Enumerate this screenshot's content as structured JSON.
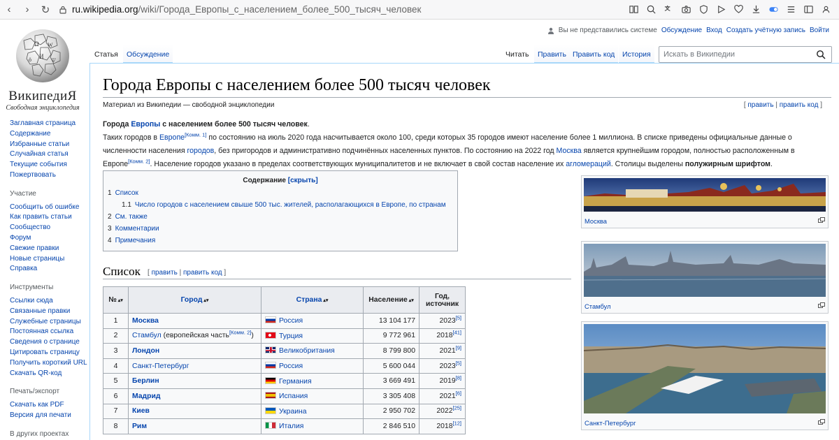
{
  "browser": {
    "url_host": "ru.wikipedia.org",
    "url_path": "/wiki/Города_Европы_с_населением_более_500_тысяч_человек"
  },
  "logo": {
    "wordmark": "ВикипедиЯ",
    "tagline": "Свободная энциклопедия"
  },
  "sidebar": {
    "nav": [
      "Заглавная страница",
      "Содержание",
      "Избранные статьи",
      "Случайная статья",
      "Текущие события",
      "Пожертвовать"
    ],
    "participation_title": "Участие",
    "participation": [
      "Сообщить об ошибке",
      "Как править статьи",
      "Сообщество",
      "Форум",
      "Свежие правки",
      "Новые страницы",
      "Справка"
    ],
    "tools_title": "Инструменты",
    "tools": [
      "Ссылки сюда",
      "Связанные правки",
      "Служебные страницы",
      "Постоянная ссылка",
      "Сведения о странице",
      "Цитировать страницу",
      "Получить короткий URL",
      "Скачать QR-код"
    ],
    "print_title": "Печать/экспорт",
    "print": [
      "Скачать как PDF",
      "Версия для печати"
    ],
    "other_title": "В других проектах"
  },
  "userbar": {
    "not_logged": "Вы не представились системе",
    "discussion": "Обсуждение",
    "login": "Вход",
    "create": "Создать учётную запись",
    "logout": "Войти"
  },
  "tabs": {
    "article": "Статья",
    "talk": "Обсуждение",
    "read": "Читать",
    "edit": "Править",
    "edit_code": "Править код",
    "history": "История"
  },
  "search": {
    "placeholder": "Искать в Википедии"
  },
  "article": {
    "title": "Города Европы с населением более 500 тысяч человек",
    "from": "Материал из Википедии — свободной энциклопедии",
    "edit_links": {
      "open": "[ ",
      "edit": "править",
      "sep": " | ",
      "edit_code": "править код",
      "close": " ]"
    },
    "intro": {
      "p1a": "Города ",
      "p1link": "Европы",
      "p1b": " с населением более 500 тысяч человек",
      "p2a": "Таких городов в ",
      "p2link1": "Европе",
      "p2sup1": "[Комм. 1]",
      "p2b": " по состоянию на июль 2020 года насчитывается около 100, среди которых 35 городов имеют население более 1 миллиона. В списке приведены официальные данные о численности населения ",
      "p2link2": "городов",
      "p2c": ", без пригородов и административно подчинённых населенных пунктов. По состоянию на 2022 год ",
      "p2link3": "Москва",
      "p2d": " является крупнейшим городом, полностью расположенным в Европе",
      "p2sup2": "[Комм. 2]",
      "p2e": ". Население городов указано в пределах соответствующих муниципалитетов и не включает в свой состав население их ",
      "p2link4": "агломераций",
      "p2f": ". Столицы выделены ",
      "p2bold": "полужирным шрифтом",
      "p2g": "."
    },
    "toc": {
      "title": "Содержание",
      "hide": "[скрыть]",
      "items": [
        {
          "num": "1",
          "label": "Список"
        },
        {
          "num": "1.1",
          "label": "Число городов с населением свыше 500 тыс. жителей, располагающихся в Европе, по странам"
        },
        {
          "num": "2",
          "label": "См. также"
        },
        {
          "num": "3",
          "label": "Комментарии"
        },
        {
          "num": "4",
          "label": "Примечания"
        }
      ]
    },
    "section": {
      "title": "Список",
      "edit_open": "[ ",
      "edit": "править",
      "sep": " | ",
      "edit_code": "править код",
      "edit_close": " ]"
    }
  },
  "table": {
    "headers": {
      "num": "№",
      "city": "Город",
      "country": "Страна",
      "pop": "Население",
      "year_l1": "Год,",
      "year_l2": "источник"
    },
    "rows": [
      {
        "n": "1",
        "city": "Москва",
        "note": "",
        "sup": "",
        "capital": true,
        "country": "Россия",
        "flag": "ru",
        "pop": "13 104 177",
        "year": "2023",
        "ref": "[5]"
      },
      {
        "n": "2",
        "city": "Стамбул",
        "note": " (европейская часть",
        "sup": "[Комм. 2]",
        "capital": false,
        "country": "Турция",
        "flag": "tr",
        "pop": "9 772 961",
        "year": "2018",
        "ref": "[41]"
      },
      {
        "n": "3",
        "city": "Лондон",
        "note": "",
        "sup": "",
        "capital": true,
        "country": "Великобритания",
        "flag": "gb",
        "pop": "8 799 800",
        "year": "2021",
        "ref": "[9]"
      },
      {
        "n": "4",
        "city": "Санкт-Петербург",
        "note": "",
        "sup": "",
        "capital": false,
        "country": "Россия",
        "flag": "ru",
        "pop": "5 600 044",
        "year": "2023",
        "ref": "[5]"
      },
      {
        "n": "5",
        "city": "Берлин",
        "note": "",
        "sup": "",
        "capital": true,
        "country": "Германия",
        "flag": "de",
        "pop": "3 669 491",
        "year": "2019",
        "ref": "[8]"
      },
      {
        "n": "6",
        "city": "Мадрид",
        "note": "",
        "sup": "",
        "capital": true,
        "country": "Испания",
        "flag": "es",
        "pop": "3 305 408",
        "year": "2021",
        "ref": "[6]"
      },
      {
        "n": "7",
        "city": "Киев",
        "note": "",
        "sup": "",
        "capital": true,
        "country": "Украина",
        "flag": "ua",
        "pop": "2 950 702",
        "year": "2022",
        "ref": "[25]"
      },
      {
        "n": "8",
        "city": "Рим",
        "note": "",
        "sup": "",
        "capital": true,
        "country": "Италия",
        "flag": "it",
        "pop": "2 846 510",
        "year": "2018",
        "ref": "[12]"
      }
    ]
  },
  "images": [
    {
      "caption": "Москва"
    },
    {
      "caption": "Стамбул"
    },
    {
      "caption": "Санкт-Петербург"
    }
  ],
  "colors": {
    "link": "#0645ad",
    "border": "#a2a9b1",
    "tab_border": "#a7d7f9"
  }
}
